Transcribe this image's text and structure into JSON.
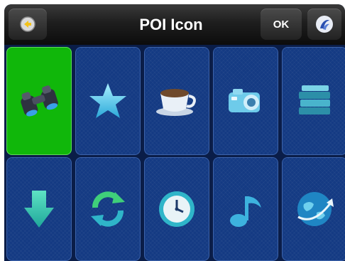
{
  "header": {
    "title": "POI Icon",
    "ok_label": "OK",
    "back_icon": "back-arrow-icon",
    "logo_icon": "app-logo-icon"
  },
  "colors": {
    "tile": "#143a83",
    "selected": "#10b70a",
    "header": "#1e1e1e"
  },
  "icons": [
    {
      "name": "binoculars-icon",
      "selected": true
    },
    {
      "name": "star-icon",
      "selected": false
    },
    {
      "name": "coffee-cup-icon",
      "selected": false
    },
    {
      "name": "camera-icon",
      "selected": false
    },
    {
      "name": "books-icon",
      "selected": false
    },
    {
      "name": "down-arrow-icon",
      "selected": false
    },
    {
      "name": "refresh-icon",
      "selected": false
    },
    {
      "name": "clock-icon",
      "selected": false
    },
    {
      "name": "music-note-icon",
      "selected": false
    },
    {
      "name": "globe-icon",
      "selected": false
    }
  ]
}
